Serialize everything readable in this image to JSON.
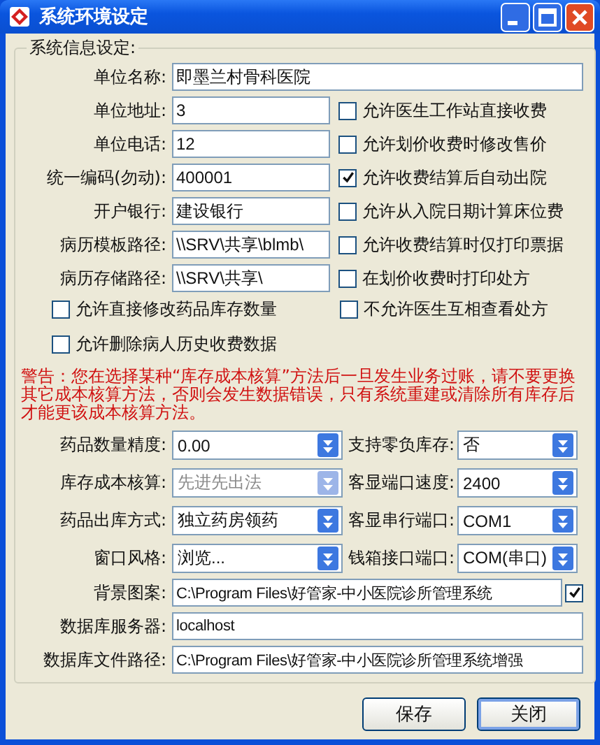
{
  "window": {
    "title": "系统环境设定"
  },
  "group": {
    "title": "系统信息设定:"
  },
  "unit_name": {
    "label": "单位名称:",
    "value": "即墨兰村骨科医院"
  },
  "info_rows": [
    {
      "label": "单位地址:",
      "value": "3",
      "option": {
        "label": "允许医生工作站直接收费",
        "checked": false
      }
    },
    {
      "label": "单位电话:",
      "value": "12",
      "option": {
        "label": "允许划价收费时修改售价",
        "checked": false
      }
    },
    {
      "label": "统一编码(勿动):",
      "value": "400001",
      "option": {
        "label": "允许收费结算后自动出院",
        "checked": true
      }
    },
    {
      "label": "开户银行:",
      "value": "建设银行",
      "option": {
        "label": "允许从入院日期计算床位费",
        "checked": false
      }
    },
    {
      "label": "病历模板路径:",
      "value": "\\\\SRV\\共享\\blmb\\",
      "option": {
        "label": "允许收费结算时仅打印票据",
        "checked": false
      }
    },
    {
      "label": "病历存储路径:",
      "value": "\\\\SRV\\共享\\",
      "option": {
        "label": "在划价收费时打印处方",
        "checked": false
      }
    }
  ],
  "bottom_options": [
    {
      "label": "允许直接修改药品库存数量",
      "checked": false
    },
    {
      "label": "不允许医生互相查看处方",
      "checked": false
    },
    {
      "label": "允许删除病人历史收费数据",
      "checked": false
    }
  ],
  "warning": "警告：您在选择某种“库存成本核算”方法后一旦发生业务过账，请不要更换其它成本核算方法，否则会发生数据错误，只有系统重建或清除所有库存后才能更该成本核算方法。",
  "dropdowns": [
    {
      "label": "药品数量精度:",
      "value": "0.00",
      "disabled": false
    },
    {
      "label": "支持零负库存:",
      "value": "否",
      "disabled": false
    },
    {
      "label": "库存成本核算:",
      "value": "先进先出法",
      "disabled": true
    },
    {
      "label": "客显端口速度:",
      "value": "2400",
      "disabled": false
    },
    {
      "label": "药品出库方式:",
      "value": "独立药房领药",
      "disabled": false
    },
    {
      "label": "客显串行端口:",
      "value": "COM1",
      "disabled": false
    },
    {
      "label": "窗口风格:",
      "value": "浏览...",
      "disabled": false
    },
    {
      "label": "钱箱接口端口:",
      "value": "COM(串口)",
      "disabled": false
    }
  ],
  "paths": [
    {
      "label": "背景图案:",
      "value": "C:\\Program Files\\好管家-中小医院诊所管理系统",
      "kind": "check",
      "checked": true
    },
    {
      "label": "数据库服务器:",
      "value": "localhost",
      "kind": "plain"
    },
    {
      "label": "数据库文件路径:",
      "value": "C:\\Program Files\\好管家-中小医院诊所管理系统增强",
      "kind": "plain"
    }
  ],
  "buttons": [
    {
      "label": "保存",
      "focused": false
    },
    {
      "label": "关闭",
      "focused": true
    }
  ]
}
